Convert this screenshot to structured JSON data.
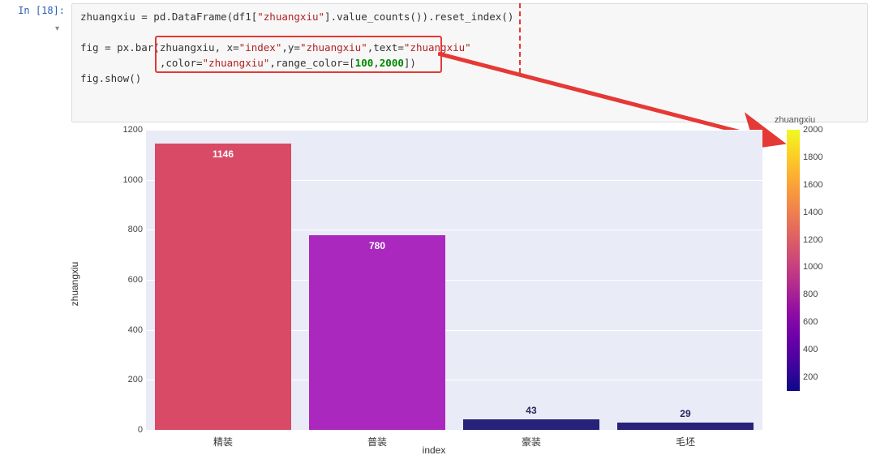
{
  "cell": {
    "prompt_prefix": "In [",
    "prompt_num": "18",
    "prompt_suffix": "]:",
    "line1_pre": "zhuangxiu = pd.DataFrame(df1[",
    "line1_str": "\"zhuangxiu\"",
    "line1_post": "].value_counts()).reset_index()",
    "line2_pre": "fig = px.bar(zhuangxiu, x=",
    "line2_s1": "\"index\"",
    "line2_mid1": ",y=",
    "line2_s2": "\"zhuangxiu\"",
    "line2_mid2": ",text=",
    "line2_s3": "\"zhuangxiu\"",
    "line3_pre": "             ,color=",
    "line3_s1": "\"zhuangxiu\"",
    "line3_mid": ",range_color=[",
    "line3_n1": "100",
    "line3_sep": ",",
    "line3_n2": "2000",
    "line3_post": "])",
    "line4": "fig.show()"
  },
  "chart_data": {
    "type": "bar",
    "categories": [
      "精装",
      "普装",
      "豪装",
      "毛坯"
    ],
    "values": [
      1146,
      780,
      43,
      29
    ],
    "xlabel": "index",
    "ylabel": "zhuangxiu",
    "ylim": [
      0,
      1200
    ],
    "yticks": [
      0,
      200,
      400,
      600,
      800,
      1000,
      1200
    ],
    "colorbar": {
      "title": "zhuangxiu",
      "range": [
        100,
        2000
      ],
      "ticks": [
        200,
        400,
        600,
        800,
        1000,
        1200,
        1400,
        1600,
        1800,
        2000
      ]
    },
    "colors": [
      "#d94a66",
      "#aa28be",
      "#28217a",
      "#28217a"
    ]
  }
}
